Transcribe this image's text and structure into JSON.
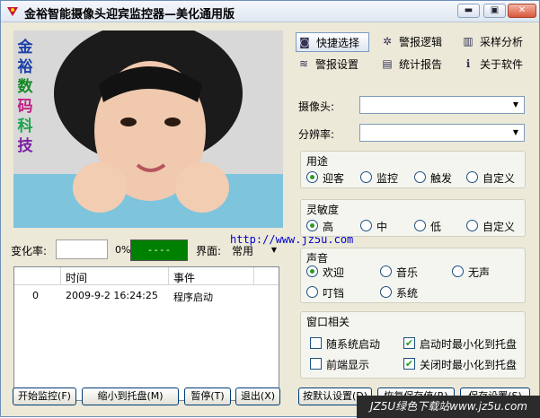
{
  "window": {
    "title": "金裕智能摄像头迎宾监控器—美化通用版",
    "minimize": "▬",
    "maximize": "▣",
    "close": "✕"
  },
  "left_panel": {
    "vertical_logo": [
      "金",
      "裕",
      "数",
      "码",
      "科",
      "技"
    ],
    "change_rate_label": "变化率:",
    "change_rate_percent": "0%",
    "status_value": "----",
    "interface_label": "界面:",
    "interface_value": "常用",
    "link_text": "http://www.jz5u.com",
    "log": {
      "columns": [
        "",
        "时间",
        "事件"
      ],
      "rows": [
        {
          "index": "0",
          "time": "2009-9-2 16:24:25",
          "event": "程序启动"
        }
      ]
    },
    "buttons": {
      "start": "开始监控(F)",
      "tray": "缩小到托盘(M)",
      "pause": "暂停(T)",
      "exit": "退出(X)"
    }
  },
  "tabs": [
    {
      "label": "快捷选择",
      "icon": "camera-icon"
    },
    {
      "label": "警报逻辑",
      "icon": "gear-icon"
    },
    {
      "label": "采样分析",
      "icon": "bars-icon"
    },
    {
      "label": "警报设置",
      "icon": "wave-icon"
    },
    {
      "label": "统计报告",
      "icon": "report-icon"
    },
    {
      "label": "关于软件",
      "icon": "info-icon"
    }
  ],
  "settings": {
    "camera_label": "摄像头:",
    "camera_value": "",
    "resolution_label": "分辨率:",
    "resolution_value": "",
    "purpose": {
      "title": "用途",
      "options": [
        "迎客",
        "监控",
        "触发",
        "自定义"
      ],
      "selected": 0
    },
    "sensitivity": {
      "title": "灵敏度",
      "options": [
        "高",
        "中",
        "低",
        "自定义"
      ],
      "selected": 0
    },
    "sound": {
      "title": "声音",
      "options": [
        "欢迎",
        "音乐",
        "无声",
        "叮铛",
        "系统"
      ],
      "selected": 0
    },
    "window_group": {
      "title": "窗口相关",
      "checks": [
        {
          "label": "随系统启动",
          "checked": false
        },
        {
          "label": "启动时最小化到托盘",
          "checked": true
        },
        {
          "label": "前端显示",
          "checked": false
        },
        {
          "label": "关闭时最小化到托盘",
          "checked": true
        }
      ]
    },
    "buttons": {
      "default": "按默认设置(D)",
      "restore": "恢复保存值(R)",
      "save": "保存设置(S)"
    }
  },
  "watermark": "JZ5U绿色下载站www.jz5u.com",
  "colors": {
    "status_green": "#008000",
    "window_bg": "#ece9d8"
  }
}
